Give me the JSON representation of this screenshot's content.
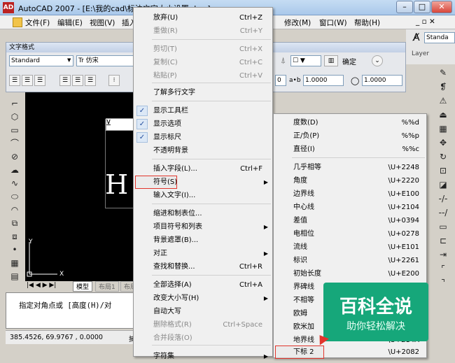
{
  "window": {
    "app_icon": "AD",
    "title": "AutoCAD 2007 - [E:\\我的cad\\标注文字大小设置.dwg]",
    "min": "–",
    "max": "□",
    "close": "✕"
  },
  "menubar": {
    "items": [
      "文件(F)",
      "编辑(E)",
      "视图(V)",
      "插入",
      "修改(M)",
      "窗口(W)",
      "帮助(H)"
    ],
    "right": "_ ▫ ✕"
  },
  "right_strip": {
    "standard": "Standa",
    "layer": "Layer"
  },
  "text_formatting": {
    "caption": "文字格式",
    "style": "Standard",
    "font": "Tr 仿宋",
    "ok": "确定",
    "tracking": "1.0000",
    "width": "1.0000",
    "oblique": "0",
    "ab_label": "a•b"
  },
  "drawing": {
    "big_text": "H",
    "ucs_x": "X",
    "ucs_y": "Y"
  },
  "tabs": {
    "model": "模型",
    "layout1": "布局1",
    "layout2": "布局"
  },
  "command": {
    "line1": "指定对角点或 [高度(H)/对"
  },
  "status": {
    "coords": "385.4526, 69.9767 , 0.0000",
    "snap": "捕"
  },
  "context_menu": {
    "items": [
      {
        "label": "放弃(U)",
        "shortcut": "Ctrl+Z"
      },
      {
        "label": "重做(R)",
        "shortcut": "Ctrl+Y",
        "disabled": true
      },
      {
        "label": "剪切(T)",
        "shortcut": "Ctrl+X",
        "disabled": true
      },
      {
        "label": "复制(C)",
        "shortcut": "Ctrl+C",
        "disabled": true
      },
      {
        "label": "粘贴(P)",
        "shortcut": "Ctrl+V",
        "disabled": true
      },
      {
        "label": "了解多行文字"
      },
      {
        "label": "显示工具栏",
        "checked": true
      },
      {
        "label": "显示选项",
        "checked": true
      },
      {
        "label": "显示标尺",
        "checked": true
      },
      {
        "label": "不透明背景"
      },
      {
        "label": "插入字段(L)...",
        "shortcut": "Ctrl+F"
      },
      {
        "label": "符号(S)",
        "submenu": true,
        "highlighted": true
      },
      {
        "label": "输入文字(I)..."
      },
      {
        "label": "缩进和制表位..."
      },
      {
        "label": "项目符号和列表",
        "submenu": true
      },
      {
        "label": "背景遮罩(B)..."
      },
      {
        "label": "对正",
        "submenu": true
      },
      {
        "label": "查找和替换...",
        "shortcut": "Ctrl+R"
      },
      {
        "label": "全部选择(A)",
        "shortcut": "Ctrl+A"
      },
      {
        "label": "改变大小写(H)",
        "submenu": true
      },
      {
        "label": "自动大写"
      },
      {
        "label": "删除格式(R)",
        "shortcut": "Ctrl+Space",
        "disabled": true
      },
      {
        "label": "合并段落(O)",
        "disabled": true
      },
      {
        "label": "字符集",
        "submenu": true
      }
    ]
  },
  "symbol_menu": {
    "items": [
      {
        "label": "度数(D)",
        "code": "%%d"
      },
      {
        "label": "正/负(P)",
        "code": "%%p"
      },
      {
        "label": "直径(I)",
        "code": "%%c"
      },
      {
        "label": "几乎相等",
        "code": "\\U+2248"
      },
      {
        "label": "角度",
        "code": "\\U+2220"
      },
      {
        "label": "边界线",
        "code": "\\U+E100"
      },
      {
        "label": "中心线",
        "code": "\\U+2104"
      },
      {
        "label": "差值",
        "code": "\\U+0394"
      },
      {
        "label": "电相位",
        "code": "\\U+0278"
      },
      {
        "label": "流线",
        "code": "\\U+E101"
      },
      {
        "label": "标识",
        "code": "\\U+2261"
      },
      {
        "label": "初始长度",
        "code": "\\U+E200"
      },
      {
        "label": "界碑线",
        "code": "\\U+E102"
      },
      {
        "label": "不相等",
        "code": ""
      },
      {
        "label": "欧姆",
        "code": ""
      },
      {
        "label": "欧米加",
        "code": ""
      },
      {
        "label": "地界线",
        "code": "\\U+214A"
      },
      {
        "label": "下标 2",
        "code": "\\U+2082",
        "highlighted": true
      }
    ]
  },
  "watermark": {
    "title": "百科全说",
    "subtitle": "助你轻松解决"
  }
}
